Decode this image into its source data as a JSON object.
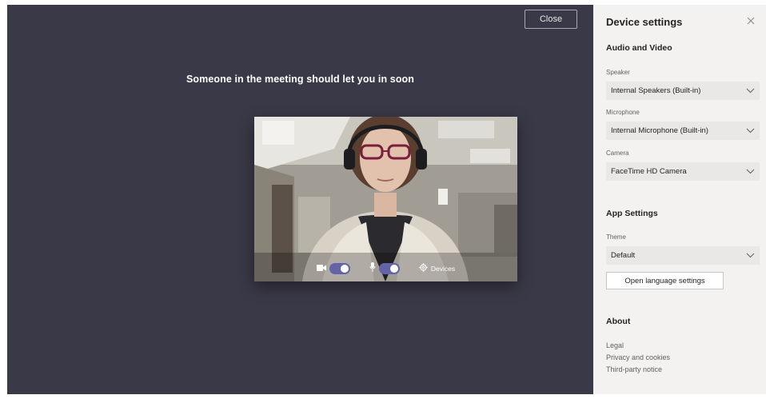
{
  "stage": {
    "close_label": "Close",
    "lobby_message": "Someone in the meeting should let you in soon",
    "preview": {
      "camera_on": true,
      "mic_on": true,
      "devices_label": "Devices"
    }
  },
  "panel": {
    "title": "Device settings",
    "audio_video_heading": "Audio and Video",
    "speaker": {
      "label": "Speaker",
      "value": "Internal Speakers (Built-in)"
    },
    "microphone": {
      "label": "Microphone",
      "value": "Internal Microphone (Built-in)"
    },
    "camera": {
      "label": "Camera",
      "value": "FaceTime HD Camera"
    },
    "app_settings_heading": "App Settings",
    "theme": {
      "label": "Theme",
      "value": "Default"
    },
    "language_button": "Open language settings",
    "about_heading": "About",
    "about_links": [
      "Legal",
      "Privacy and cookies",
      "Third-party notice"
    ]
  },
  "icons": {
    "close": "close-icon",
    "chevron": "chevron-down-icon",
    "camera": "camera-icon",
    "mic": "microphone-icon",
    "gear": "gear-icon"
  },
  "colors": {
    "stage_bg": "#3a3947",
    "panel_bg": "#f3f2f1",
    "toggle_accent": "#6264a7"
  }
}
